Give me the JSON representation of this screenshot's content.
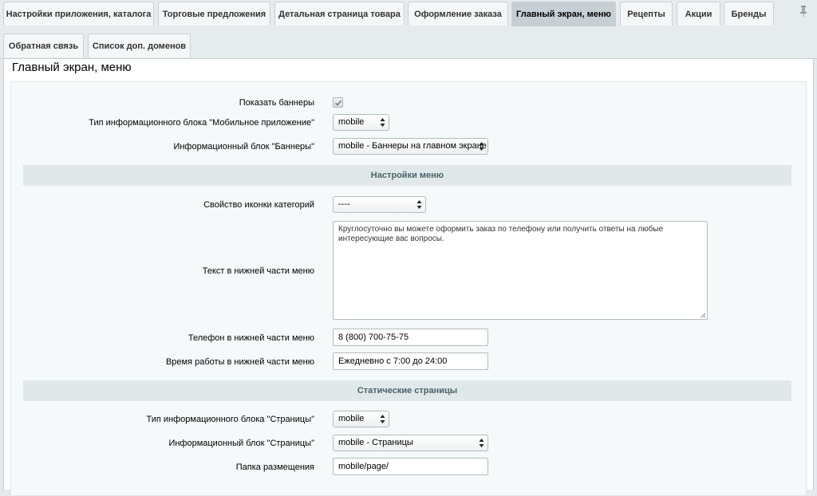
{
  "tabs_row1": [
    {
      "label": "Настройки приложения, каталога"
    },
    {
      "label": "Торговые предложения"
    },
    {
      "label": "Детальная страница товара"
    },
    {
      "label": "Оформление заказа"
    },
    {
      "label": "Главный экран, меню"
    },
    {
      "label": "Рецепты"
    },
    {
      "label": "Акции"
    },
    {
      "label": "Бренды"
    }
  ],
  "tabs_row2": [
    {
      "label": "Обратная связь"
    },
    {
      "label": "Список доп. доменов"
    }
  ],
  "active_tab": "Главный экран, меню",
  "pin_icon": "pin-icon",
  "panel_title": "Главный экран, меню",
  "fields": {
    "show_banners": {
      "label": "Показать баннеры",
      "checked": true
    },
    "mobile_iblock_type": {
      "label": "Тип информационного блока \"Мобильное приложение\"",
      "value": "mobile"
    },
    "banners_iblock": {
      "label": "Информационный блок \"Баннеры\"",
      "value": "mobile - Баннеры на главном экране"
    }
  },
  "menu_section": {
    "title": "Настройки меню",
    "category_icon": {
      "label": "Свойство иконки категорий",
      "value": "----"
    },
    "bottom_text": {
      "label": "Текст в нижней части меню",
      "value": "Круглосуточно вы можете оформить заказ по телефону или получить ответы на любые интересующие вас вопросы."
    },
    "phone": {
      "label": "Телефон в нижней части меню",
      "value": "8 (800) 700-75-75"
    },
    "work_time": {
      "label": "Время работы в нижней части меню",
      "value": "Ежедневно с 7:00 до 24:00"
    }
  },
  "static_section": {
    "title": "Статические страницы",
    "pages_iblock_type": {
      "label": "Тип информационного блока \"Страницы\"",
      "value": "mobile"
    },
    "pages_iblock": {
      "label": "Информационный блок \"Страницы\"",
      "value": "mobile - Страницы"
    },
    "folder": {
      "label": "Папка размещения",
      "value": "mobile/page/"
    }
  },
  "colors": {
    "tab_bg": "#f4f6f7",
    "tab_active_bg": "#c6d0d4",
    "section_bg": "#e0e8ea",
    "section_text": "#4b6267",
    "form_bg": "#f5f9f9"
  }
}
